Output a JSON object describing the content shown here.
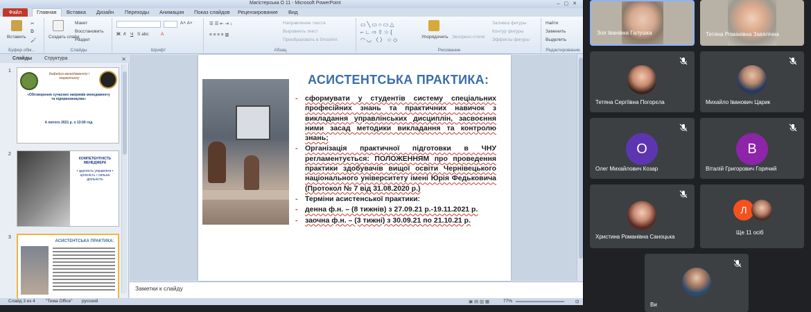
{
  "ppt": {
    "window_title": "Магістерська О 11 - Microsoft PowerPoint",
    "tabs": [
      "Файл",
      "Главная",
      "Вставка",
      "Дизайн",
      "Переходы",
      "Анимация",
      "Показ слайдов",
      "Рецензирование",
      "Вид"
    ],
    "ribbon": {
      "paste": "Вставить",
      "clipboard_label": "Буфер обм...",
      "new_slide": "Создать слайд",
      "layout": "Макет",
      "reset": "Восстановить",
      "section": "Раздел",
      "slides_label": "Слайды",
      "font_label": "Шрифт",
      "para_label": "Абзац",
      "text_direction": "Направление текста",
      "align_text": "Выровнять текст",
      "smartart": "Преобразовать в SmartArt",
      "drawing_label": "Рисование",
      "arrange": "Упорядочить",
      "express_styles": "Экспресс-стили",
      "fill": "Заливка фигуры",
      "outline": "Контур фигуры",
      "effects": "Эффекты фигуры",
      "find": "Найти",
      "replace": "Заменить",
      "select": "Выделить",
      "editing_label": "Редактирование"
    },
    "pane_tabs": [
      "Слайды",
      "Структура"
    ],
    "slide_numbers": [
      "1",
      "2",
      "3"
    ],
    "thumb1": {
      "header": "Кафедра менеджменту і маркетингу",
      "title": "«Обговорення сучасних напрямів менеджменту та підприємництва»",
      "date": "4 лютого 2021 р. о 13:00 год"
    },
    "thumb2": {
      "caption": "КОМПЕТЕНТНІСТЬ МЕНЕДЖЕРА",
      "sub": "• здатність управляти • цілісність • сильна діяльність"
    },
    "thumb3": {
      "title": "АСИСТЕНТСЬКА ПРАКТИКА:"
    },
    "slide": {
      "title": "АСИСТЕНТСЬКА ПРАКТИКА:",
      "bullets": [
        "сформувати у студентів систему спеціальних професійних знань та практичних навичок з викладання управлінських дисциплін, засвоєння ними засад методики викладання та контролю знань;",
        "Організація практичної підготовки в ЧНУ регламентується: ПОЛОЖЕННЯМ про проведення практики здобувачів вищої освіти Чернівецького національного університету імені Юрія Федьковича (Протокол № 7 від 31.08.2020 р.)",
        "Терміни асистенської практики:",
        "денна ф.н. – (8 тижнів) з 27.09.21 р.-19.11.2021 р.",
        "заочна ф.н. – (3 тижні) з 30.09.21 по 21.10.21 р."
      ]
    },
    "notes_placeholder": "Заметки к слайду",
    "status": {
      "slide": "Слайд 3 из 4",
      "theme": "\"Тема Office\"",
      "language": "русский",
      "zoom": "77%"
    }
  },
  "participants": [
    {
      "name": "Зоя Іванівна Галушка",
      "kind": "video"
    },
    {
      "name": "Тетяна Романівна Завялічна",
      "kind": "video"
    },
    {
      "name": "Тетяна Сергіївна Погорєла",
      "kind": "photo"
    },
    {
      "name": "Михайло Іванович Царик",
      "kind": "photo"
    },
    {
      "name": "Олег Михайлович Козар",
      "kind": "letter",
      "letter": "О",
      "color": "#5e35b1"
    },
    {
      "name": "Віталій Григорович Горячий",
      "kind": "letter",
      "letter": "В",
      "color": "#8e24aa"
    },
    {
      "name": "Христина Романівна Саноцька",
      "kind": "photo"
    },
    {
      "name": "Ще 11 осіб",
      "kind": "more",
      "letter": "Л",
      "color": "#f4511e"
    },
    {
      "name": "Ви",
      "kind": "photo"
    }
  ],
  "colors": {
    "accent_title": "#3a6da8",
    "file_tab": "#c0392b",
    "meet_bg": "#202124",
    "tile_bg": "#3c4043"
  }
}
